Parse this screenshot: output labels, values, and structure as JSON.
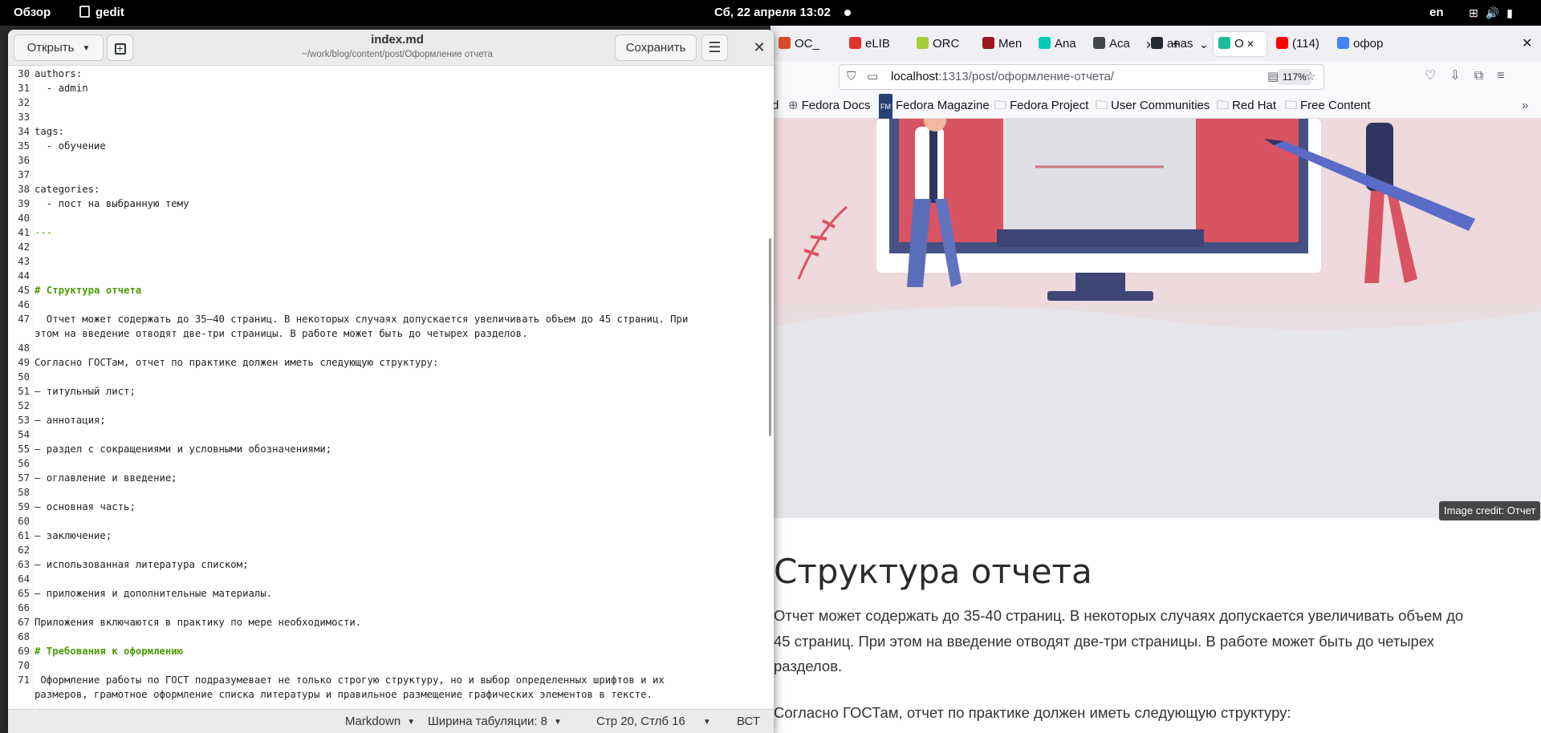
{
  "topbar": {
    "overview": "Обзор",
    "app_name": "gedit",
    "clock": "Сб, 22 апреля  13:02",
    "lang": "en"
  },
  "firefox": {
    "tabs": [
      {
        "label": "ОС_",
        "icon": "oc-favicon",
        "color": "#d94b2b"
      },
      {
        "label": "eLIB",
        "icon": "elibrary-favicon",
        "color": "#e0322f"
      },
      {
        "label": "ORC",
        "icon": "orcid-favicon",
        "color": "#a6ce39"
      },
      {
        "label": "Men",
        "icon": "mendeley-favicon",
        "color": "#9d1620"
      },
      {
        "label": "Ana",
        "icon": "researchgate-favicon",
        "color": "#00ccbb"
      },
      {
        "label": "Aca",
        "icon": "academia-favicon",
        "color": "#41454a"
      },
      {
        "label": "anas",
        "icon": "github-favicon",
        "color": "#24292f"
      },
      {
        "label": "О",
        "icon": "hugo-academic-favicon",
        "color": "#1abc9c"
      },
      {
        "label": "(114)",
        "icon": "youtube-favicon",
        "color": "#ff0000"
      },
      {
        "label": "офор",
        "icon": "google-favicon",
        "color": "#4285f4"
      }
    ],
    "url_host": "localhost",
    "url_path": ":1313/post/оформление-отчета/",
    "zoom": "117%",
    "bookmarks": [
      {
        "label": "d"
      },
      {
        "label": "Fedora Docs"
      },
      {
        "label": "Fedora Magazine"
      },
      {
        "label": "Fedora Project"
      },
      {
        "label": "User Communities"
      },
      {
        "label": "Red Hat"
      },
      {
        "label": "Free Content"
      }
    ],
    "image_credit": "Image credit: Отчет",
    "article_title": "Структура отчета",
    "article_p1": "Отчет может содержать до 35-40 страниц. В некоторых случаях допускается увеличивать объем до 45 страниц. При этом на введение отводят две-три страницы. В работе может быть до четырех разделов.",
    "article_p2": "Согласно ГОСТам, отчет по практике должен иметь следующую структуру:"
  },
  "gedit": {
    "open_label": "Открыть",
    "save_label": "Сохранить",
    "title": "index.md",
    "path": "~/work/blog/content/post/Оформление отчета",
    "lines": [
      {
        "n": "30",
        "text": "authors:",
        "style": "plain"
      },
      {
        "n": "31",
        "text": "  - admin",
        "style": "plain"
      },
      {
        "n": "32",
        "text": "",
        "style": "plain"
      },
      {
        "n": "33",
        "text": "",
        "style": "plain"
      },
      {
        "n": "34",
        "text": "tags:",
        "style": "plain"
      },
      {
        "n": "35",
        "text": "  - обучение",
        "style": "plain"
      },
      {
        "n": "36",
        "text": "",
        "style": "plain"
      },
      {
        "n": "37",
        "text": "",
        "style": "plain"
      },
      {
        "n": "38",
        "text": "categories:",
        "style": "plain"
      },
      {
        "n": "39",
        "text": "  - пост на выбранную тему",
        "style": "plain"
      },
      {
        "n": "40",
        "text": "",
        "style": "plain"
      },
      {
        "n": "41",
        "text": "---",
        "style": "hr"
      },
      {
        "n": "42",
        "text": "",
        "style": "plain"
      },
      {
        "n": "43",
        "text": "",
        "style": "plain"
      },
      {
        "n": "44",
        "text": "",
        "style": "plain"
      },
      {
        "n": "45",
        "text": "# Структура отчета",
        "style": "heading"
      },
      {
        "n": "46",
        "text": "",
        "style": "plain"
      },
      {
        "n": "47",
        "text": "  Отчет может содержать до 35–40 страниц. В некоторых случаях допускается увеличивать объем до 45 страниц. При",
        "style": "plain"
      },
      {
        "n": "",
        "text": "этом на введение отводят две-три страницы. В работе может быть до четырех разделов.",
        "style": "plain"
      },
      {
        "n": "48",
        "text": "",
        "style": "plain"
      },
      {
        "n": "49",
        "text": "Согласно ГОСТам, отчет по практике должен иметь следующую структуру:",
        "style": "plain"
      },
      {
        "n": "50",
        "text": "",
        "style": "plain"
      },
      {
        "n": "51",
        "text": "— титульный лист;",
        "style": "plain"
      },
      {
        "n": "52",
        "text": "",
        "style": "plain"
      },
      {
        "n": "53",
        "text": "— аннотация;",
        "style": "plain"
      },
      {
        "n": "54",
        "text": "",
        "style": "plain"
      },
      {
        "n": "55",
        "text": "— раздел с сокращениями и условными обозначениями;",
        "style": "plain"
      },
      {
        "n": "56",
        "text": "",
        "style": "plain"
      },
      {
        "n": "57",
        "text": "— оглавление и введение;",
        "style": "plain"
      },
      {
        "n": "58",
        "text": "",
        "style": "plain"
      },
      {
        "n": "59",
        "text": "— основная часть;",
        "style": "plain"
      },
      {
        "n": "60",
        "text": "",
        "style": "plain"
      },
      {
        "n": "61",
        "text": "— заключение;",
        "style": "plain"
      },
      {
        "n": "62",
        "text": "",
        "style": "plain"
      },
      {
        "n": "63",
        "text": "— использованная литература списком;",
        "style": "plain"
      },
      {
        "n": "64",
        "text": "",
        "style": "plain"
      },
      {
        "n": "65",
        "text": "— приложения и дополнительные материалы.",
        "style": "plain"
      },
      {
        "n": "66",
        "text": "",
        "style": "plain"
      },
      {
        "n": "67",
        "text": "Приложения включаются в практику по мере необходимости.",
        "style": "plain"
      },
      {
        "n": "68",
        "text": "",
        "style": "plain"
      },
      {
        "n": "69",
        "text": "# Требования к оформлению",
        "style": "heading"
      },
      {
        "n": "70",
        "text": "",
        "style": "plain"
      },
      {
        "n": "71",
        "text": " Оформление работы по ГОСТ подразумевает не только строгую структуру, но и выбор определенных шрифтов и их",
        "style": "plain"
      },
      {
        "n": "",
        "text": "размеров, грамотное оформление списка литературы и правильное размещение графических элементов в тексте.",
        "style": "plain"
      }
    ],
    "status": {
      "language": "Markdown",
      "tab_width": "Ширина табуляции: 8",
      "position": "Стр 20, Стлб 16",
      "mode": "ВСТ"
    }
  }
}
